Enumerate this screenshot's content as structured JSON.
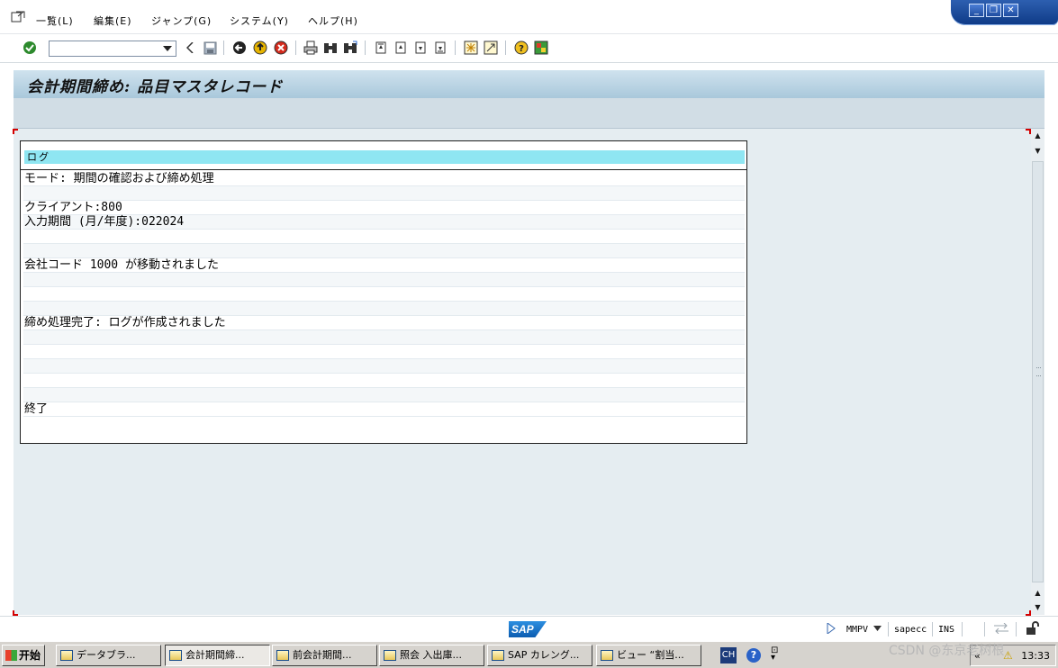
{
  "menu": {
    "items": [
      "一覧(L)",
      "編集(E)",
      "ジャンプ(G)",
      "システム(Y)",
      "ヘルプ(H)"
    ]
  },
  "window_controls": {
    "minimize": "_",
    "restore": "❐",
    "close": "✕"
  },
  "toolbar": {
    "command_field_value": "",
    "icons": [
      "enter-icon",
      "back-icon",
      "exit-icon",
      "cancel-icon",
      "print-icon",
      "find-icon",
      "find-next-icon",
      "first-page-icon",
      "prev-page-icon",
      "next-page-icon",
      "last-page-icon",
      "create-session-icon",
      "shortcut-icon",
      "help-icon",
      "layout-icon"
    ]
  },
  "screen": {
    "title": "会計期間締め: 品目マスタレコード"
  },
  "log": {
    "header": "ログ",
    "lines": [
      "モード: 期間の確認および締め処理",
      "",
      "クライアント:800",
      "入力期間 (月/年度):022024",
      "",
      "",
      "会社コード 1000 が移動されました",
      "",
      "",
      "",
      "締め処理完了: ログが作成されました",
      "",
      "",
      "",
      "",
      "",
      "終了"
    ]
  },
  "statusbar": {
    "logo": "SAP",
    "transaction": "MMPV",
    "server": "sapecc",
    "mode": "INS"
  },
  "taskbar": {
    "start": "开始",
    "tasks": [
      {
        "label": "データブラ..."
      },
      {
        "label": "会計期間締..."
      },
      {
        "label": "前会計期間..."
      },
      {
        "label": "照会 入出庫..."
      },
      {
        "label": "SAP カレング..."
      },
      {
        "label": "ビュー “割当..."
      }
    ],
    "lang": "CH",
    "clock": "13:33"
  },
  "watermark": "CSDN @东京老树根",
  "colors": {
    "title_bg": "#bcd6e6",
    "log_header_bg": "#8fe6f2",
    "content_bg": "#e5edf1"
  }
}
